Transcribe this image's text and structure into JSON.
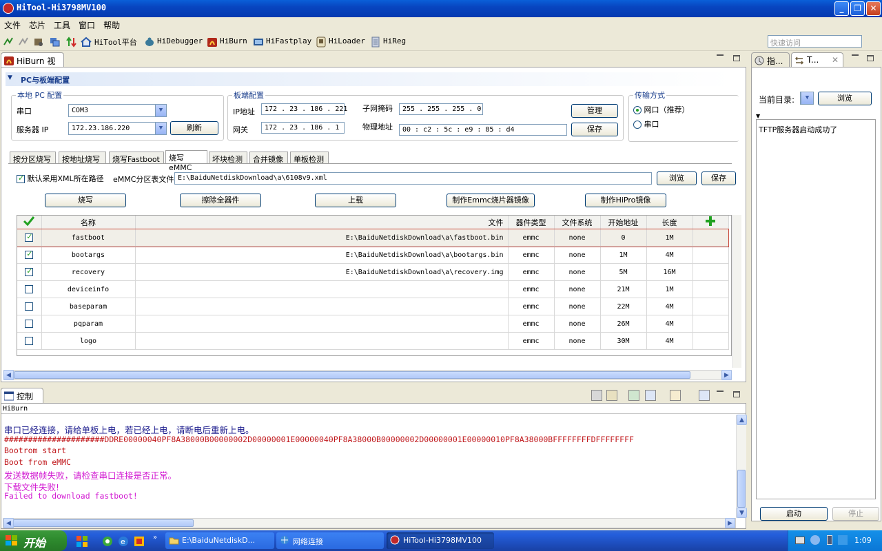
{
  "window": {
    "title": "HiTool-Hi3798MV100"
  },
  "menu": [
    "文件",
    "芯片",
    "工具",
    "窗口",
    "帮助"
  ],
  "toolbar": {
    "items": [
      "HiTool平台",
      "HiDebugger",
      "HiBurn",
      "HiFastplay",
      "HiLoader",
      "HiReg"
    ],
    "quick_access_placeholder": "快速访问"
  },
  "hiburn": {
    "view_tab": "HiBurn 视图",
    "section_title": "PC与板端配置",
    "local": {
      "legend": "本地 PC 配置",
      "serial_label": "串口",
      "serial_value": "COM3",
      "server_ip_label": "服务器 IP",
      "server_ip_value": "172.23.186.220",
      "refresh": "刷新"
    },
    "board": {
      "legend": "板端配置",
      "ip_label": "IP地址",
      "ip_value": "172 . 23 . 186 . 221",
      "gateway_label": "网关",
      "gateway_value": "172 . 23 . 186 . 1",
      "mask_label": "子网掩码",
      "mask_value": "255 . 255 . 255 . 0",
      "mac_label": "物理地址",
      "mac_value": "00  :  c2  :  5c  :  e9  :  85  :  d4",
      "manage": "管理",
      "save": "保存"
    },
    "transfer": {
      "legend": "传输方式",
      "option_net": "网口（推荐）",
      "option_serial": "串口"
    },
    "tabs": [
      "按分区烧写",
      "按地址烧写",
      "烧写Fastboot",
      "烧写eMMC",
      "坏块检测",
      "合并镜像",
      "单板检测"
    ],
    "active_tab": 3,
    "xml_default_label": "默认采用XML所在路径",
    "emmc_table_label": "eMMC分区表文件",
    "emmc_table_path": "E:\\BaiduNetdiskDownload\\a\\6108v9.xml",
    "browse": "浏览",
    "save": "保存",
    "actions": [
      "烧写",
      "擦除全器件",
      "上载",
      "制作Emmc烧片器镜像",
      "制作HiPro镜像"
    ],
    "columns": [
      "名称",
      "文件",
      "器件类型",
      "文件系统",
      "开始地址",
      "长度"
    ],
    "rows": [
      {
        "checked": true,
        "name": "fastboot",
        "file": "E:\\BaiduNetdiskDownload\\a\\fastboot.bin",
        "type": "emmc",
        "fs": "none",
        "start": "0",
        "length": "1M"
      },
      {
        "checked": true,
        "name": "bootargs",
        "file": "E:\\BaiduNetdiskDownload\\a\\bootargs.bin",
        "type": "emmc",
        "fs": "none",
        "start": "1M",
        "length": "4M"
      },
      {
        "checked": true,
        "name": "recovery",
        "file": "E:\\BaiduNetdiskDownload\\a\\recovery.img",
        "type": "emmc",
        "fs": "none",
        "start": "5M",
        "length": "16M"
      },
      {
        "checked": false,
        "name": "deviceinfo",
        "file": "",
        "type": "emmc",
        "fs": "none",
        "start": "21M",
        "length": "1M"
      },
      {
        "checked": false,
        "name": "baseparam",
        "file": "",
        "type": "emmc",
        "fs": "none",
        "start": "22M",
        "length": "4M"
      },
      {
        "checked": false,
        "name": "pqparam",
        "file": "",
        "type": "emmc",
        "fs": "none",
        "start": "26M",
        "length": "4M"
      },
      {
        "checked": false,
        "name": "logo",
        "file": "",
        "type": "emmc",
        "fs": "none",
        "start": "30M",
        "length": "4M"
      }
    ]
  },
  "right_panel": {
    "tabs": [
      "指...",
      "T..."
    ],
    "current_dir_label": "当前目录:",
    "browse": "浏览",
    "message": "TFTP服务器启动成功了",
    "start": "启动",
    "stop": "停止"
  },
  "console": {
    "tab": "控制台",
    "source": "HiBurn",
    "lines": [
      {
        "text": "串口已经连接，请给单板上电，若已经上电，请断电后重新上电。",
        "color": "#1a1a8c",
        "cn": true
      },
      {
        "text": "#####################DDRE00000040PF8A38000B00000002D00000001E00000040PF8A38000B00000002D00000001E00000010PF8A38000BFFFFFFFFDFFFFFFFF",
        "color": "#c0181c",
        "cn": false
      },
      {
        "text": "Bootrom start",
        "color": "#c0181c",
        "cn": false
      },
      {
        "text": "Boot from eMMC",
        "color": "#c0181c",
        "cn": false
      },
      {
        "text": "发送数据帧失败，请检查串口连接是否正常。",
        "color": "#d21ad2",
        "cn": true
      },
      {
        "text": "下载文件失败!",
        "color": "#d21ad2",
        "cn": true
      },
      {
        "text": "Failed to download fastboot!",
        "color": "#d21ad2",
        "cn": false
      }
    ]
  },
  "taskbar": {
    "start": "开始",
    "tasks": [
      "E:\\BaiduNetdiskD...",
      "网络连接",
      "HiTool-Hi3798MV100"
    ],
    "clock": "1:09"
  },
  "colors": {
    "title_blue": "#0845c0",
    "start_green": "#2f8c2f",
    "accent_check": "#21a121"
  }
}
